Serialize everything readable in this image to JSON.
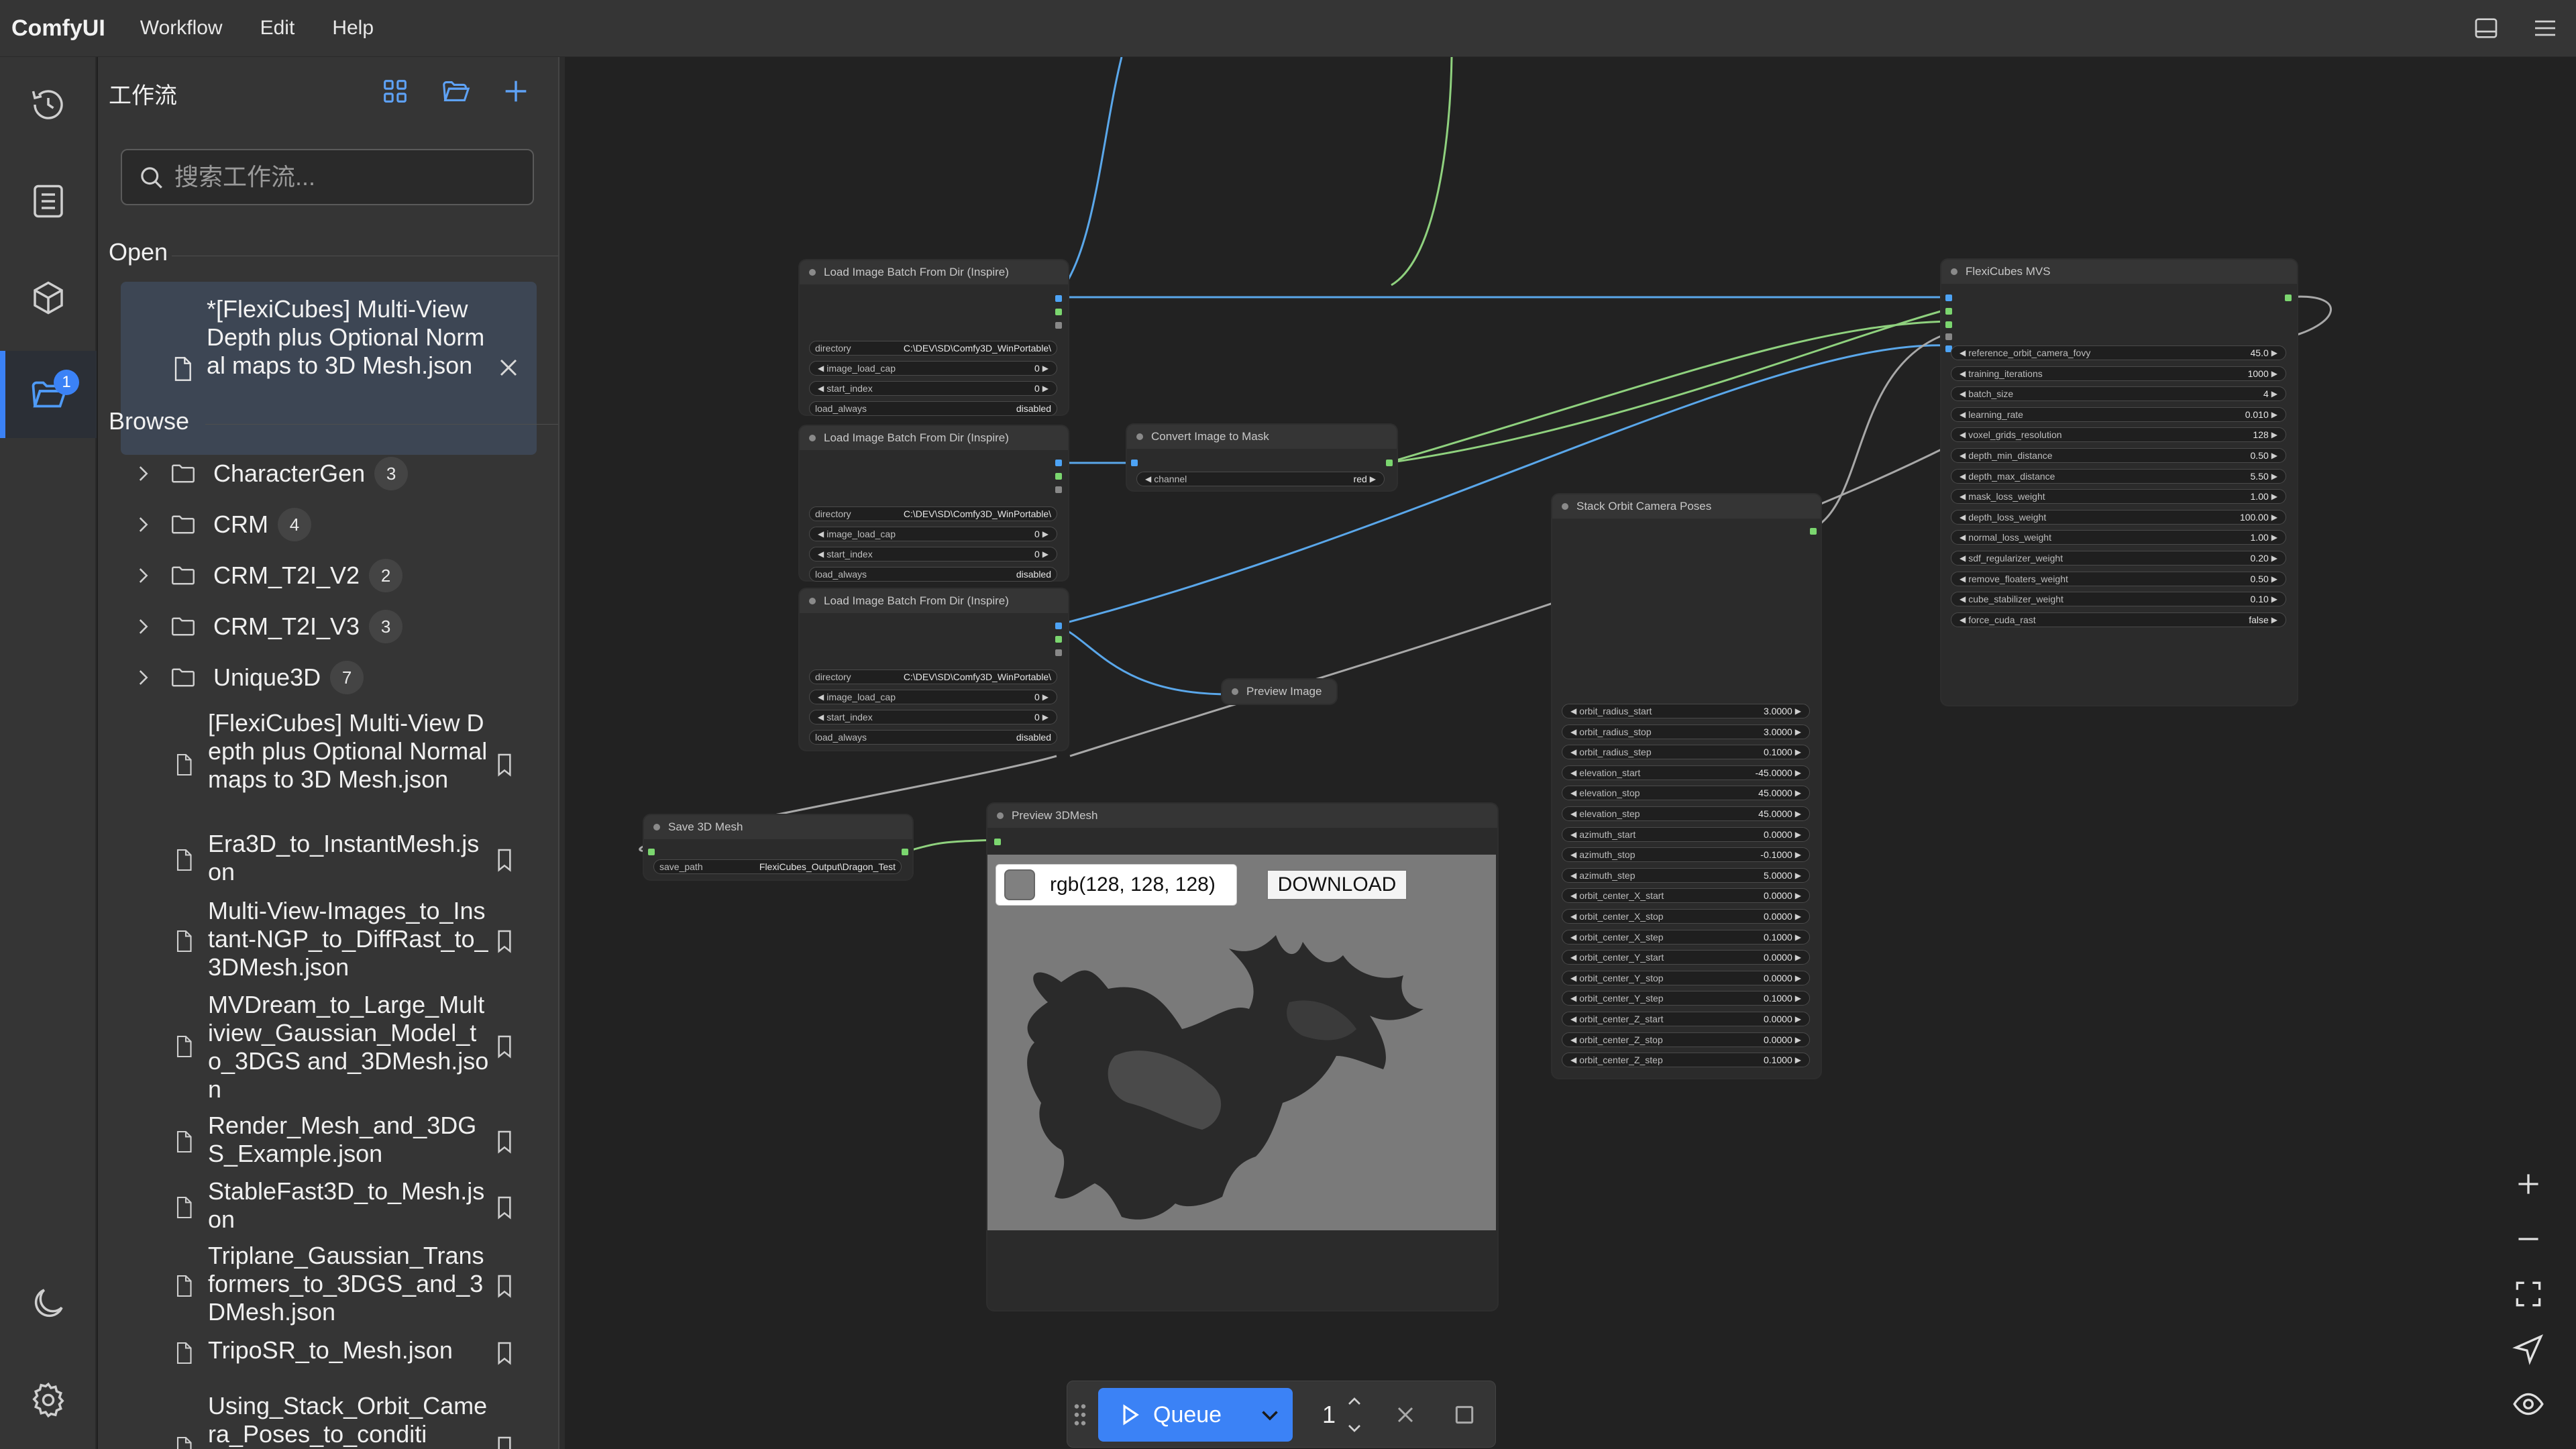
{
  "menubar": {
    "brand": "ComfyUI",
    "menus": [
      "Workflow",
      "Edit",
      "Help"
    ]
  },
  "rail": {
    "items": [
      {
        "name": "history",
        "icon": "history-icon"
      },
      {
        "name": "queue",
        "icon": "list-icon"
      },
      {
        "name": "model-library",
        "icon": "cube-icon"
      },
      {
        "name": "workflows",
        "icon": "folder-open-icon",
        "active": true,
        "badge": "1"
      }
    ],
    "bottom": [
      {
        "name": "theme",
        "icon": "moon-icon"
      },
      {
        "name": "settings",
        "icon": "gear-icon"
      }
    ]
  },
  "sidebar": {
    "title": "工作流",
    "search_placeholder": "搜索工作流...",
    "open_label": "Open",
    "open_items": [
      "*[FlexiCubes] Multi-View Depth plus Optional Normal maps to 3D Mesh.json"
    ],
    "browse_label": "Browse",
    "folders": [
      {
        "name": "CharacterGen",
        "count": "3"
      },
      {
        "name": "CRM",
        "count": "4"
      },
      {
        "name": "CRM_T2I_V2",
        "count": "2"
      },
      {
        "name": "CRM_T2I_V3",
        "count": "3"
      },
      {
        "name": "Unique3D",
        "count": "7"
      }
    ],
    "workflows": [
      "[FlexiCubes] Multi-View Depth plus Optional Normal maps to 3D Mesh.json",
      "Era3D_to_InstantMesh.json",
      "Multi-View-Images_to_Instant-NGP_to_DiffRast_to_3DMesh.json",
      "MVDream_to_Large_Multiview_Gaussian_Model_to_3DGS and_3DMesh.json",
      "Render_Mesh_and_3DGS_Example.json",
      "StableFast3D_to_Mesh.json",
      "Triplane_Gaussian_Transformers_to_3DGS_and_3DMesh.json",
      "TripoSR_to_Mesh.json",
      "Using_Stack_Orbit_Camera_Poses_to_conditi"
    ]
  },
  "nodes": {
    "load1": {
      "title": "Load Image Batch From Dir (Inspire)",
      "widgets": [
        {
          "label": "directory",
          "value": "C:\\DEV\\SD\\Comfy3D_WinPortable\\"
        },
        {
          "label": "image_load_cap",
          "value": "0"
        },
        {
          "label": "start_index",
          "value": "0"
        },
        {
          "label": "load_always",
          "value": "disabled"
        }
      ]
    },
    "load2": {
      "title": "Load Image Batch From Dir (Inspire)",
      "widgets": [
        {
          "label": "directory",
          "value": "C:\\DEV\\SD\\Comfy3D_WinPortable\\"
        },
        {
          "label": "image_load_cap",
          "value": "0"
        },
        {
          "label": "start_index",
          "value": "0"
        },
        {
          "label": "load_always",
          "value": "disabled"
        }
      ]
    },
    "load3": {
      "title": "Load Image Batch From Dir (Inspire)",
      "widgets": [
        {
          "label": "directory",
          "value": "C:\\DEV\\SD\\Comfy3D_WinPortable\\"
        },
        {
          "label": "image_load_cap",
          "value": "0"
        },
        {
          "label": "start_index",
          "value": "0"
        },
        {
          "label": "load_always",
          "value": "disabled"
        }
      ]
    },
    "convert": {
      "title": "Convert Image to Mask",
      "widgets": [
        {
          "label": "channel",
          "value": "red"
        }
      ]
    },
    "preview_image": {
      "title": "Preview Image"
    },
    "save3d": {
      "title": "Save 3D Mesh",
      "widgets": [
        {
          "label": "save_path",
          "value": "FlexiCubes_Output\\Dragon_Test"
        }
      ]
    },
    "preview3d": {
      "title": "Preview 3DMesh",
      "color_text": "rgb(128, 128, 128)",
      "download": "DOWNLOAD"
    },
    "stack": {
      "title": "Stack Orbit Camera Poses",
      "widgets": [
        {
          "label": "orbit_radius_start",
          "value": "3.0000"
        },
        {
          "label": "orbit_radius_stop",
          "value": "3.0000"
        },
        {
          "label": "orbit_radius_step",
          "value": "0.1000"
        },
        {
          "label": "elevation_start",
          "value": "-45.0000"
        },
        {
          "label": "elevation_stop",
          "value": "45.0000"
        },
        {
          "label": "elevation_step",
          "value": "45.0000"
        },
        {
          "label": "azimuth_start",
          "value": "0.0000"
        },
        {
          "label": "azimuth_stop",
          "value": "-0.1000"
        },
        {
          "label": "azimuth_step",
          "value": "5.0000"
        },
        {
          "label": "orbit_center_X_start",
          "value": "0.0000"
        },
        {
          "label": "orbit_center_X_stop",
          "value": "0.0000"
        },
        {
          "label": "orbit_center_X_step",
          "value": "0.1000"
        },
        {
          "label": "orbit_center_Y_start",
          "value": "0.0000"
        },
        {
          "label": "orbit_center_Y_stop",
          "value": "0.0000"
        },
        {
          "label": "orbit_center_Y_step",
          "value": "0.1000"
        },
        {
          "label": "orbit_center_Z_start",
          "value": "0.0000"
        },
        {
          "label": "orbit_center_Z_stop",
          "value": "0.0000"
        },
        {
          "label": "orbit_center_Z_step",
          "value": "0.1000"
        }
      ]
    },
    "flexicubes": {
      "title": "FlexiCubes MVS",
      "widgets": [
        {
          "label": "reference_orbit_camera_fovy",
          "value": "45.0"
        },
        {
          "label": "training_iterations",
          "value": "1000"
        },
        {
          "label": "batch_size",
          "value": "4"
        },
        {
          "label": "learning_rate",
          "value": "0.010"
        },
        {
          "label": "voxel_grids_resolution",
          "value": "128"
        },
        {
          "label": "depth_min_distance",
          "value": "0.50"
        },
        {
          "label": "depth_max_distance",
          "value": "5.50"
        },
        {
          "label": "mask_loss_weight",
          "value": "1.00"
        },
        {
          "label": "depth_loss_weight",
          "value": "100.00"
        },
        {
          "label": "normal_loss_weight",
          "value": "1.00"
        },
        {
          "label": "sdf_regularizer_weight",
          "value": "0.20"
        },
        {
          "label": "remove_floaters_weight",
          "value": "0.50"
        },
        {
          "label": "cube_stabilizer_weight",
          "value": "0.10"
        },
        {
          "label": "force_cuda_rast",
          "value": "false"
        }
      ]
    }
  },
  "queue": {
    "label": "Queue",
    "count": "1"
  },
  "colors": {
    "accent": "#3b82f6",
    "wire_blue": "#5aa7ea",
    "wire_green": "#8fd17e",
    "wire_gray": "#a8a8a8",
    "slot_green": "#7bd66f",
    "slot_blue": "#4da3f5"
  }
}
